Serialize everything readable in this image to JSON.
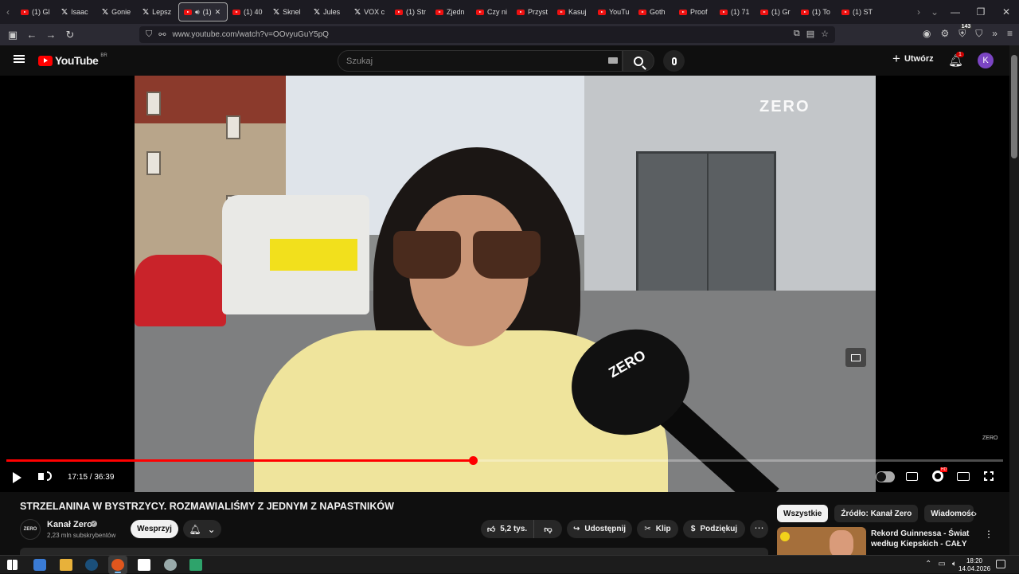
{
  "browser": {
    "tabs": [
      {
        "label": "(1) Gl",
        "icon": "youtube-icon"
      },
      {
        "label": "Isaac",
        "icon": "x-icon"
      },
      {
        "label": "Gonie",
        "icon": "x-icon"
      },
      {
        "label": "Lepsz",
        "icon": "x-icon"
      },
      {
        "label": "(1)",
        "icon": "youtube-icon",
        "active": true
      },
      {
        "label": "(1) 40",
        "icon": "youtube-icon"
      },
      {
        "label": "Sknel",
        "icon": "x-icon"
      },
      {
        "label": "Jules",
        "icon": "x-icon"
      },
      {
        "label": "VOX c",
        "icon": "x-icon"
      },
      {
        "label": "(1) Str",
        "icon": "youtube-icon"
      },
      {
        "label": "Zjedn",
        "icon": "youtube-icon"
      },
      {
        "label": "Czy ni",
        "icon": "youtube-icon"
      },
      {
        "label": "Przyst",
        "icon": "youtube-icon"
      },
      {
        "label": "Kasuj",
        "icon": "youtube-icon"
      },
      {
        "label": "YouTu",
        "icon": "youtube-icon"
      },
      {
        "label": "Goth",
        "icon": "youtube-icon"
      },
      {
        "label": "Proof",
        "icon": "youtube-icon"
      },
      {
        "label": "(1) 71",
        "icon": "youtube-icon"
      },
      {
        "label": "(1) Gr",
        "icon": "youtube-icon"
      },
      {
        "label": "(1) To",
        "icon": "youtube-icon"
      },
      {
        "label": "(1) ST",
        "icon": "youtube-icon"
      }
    ],
    "url": "www.youtube.com/watch?v=OOvyuGuY5pQ",
    "extension_badge": "143"
  },
  "youtube": {
    "logo_text": "YouTube",
    "logo_region": "BR",
    "search_placeholder": "Szukaj",
    "create_label": "Utwórz",
    "notification_count": "1",
    "avatar_letter": "K",
    "avatar_color": "#7b45c3"
  },
  "player": {
    "overlay_brand": "ZERO",
    "mic_brand": "ZERO",
    "watermark": "ZERO",
    "current_time": "17:15",
    "duration": "36:39",
    "time_display": "17:15 / 36:39",
    "progress_fraction": 0.4681,
    "settings_badge": "HD"
  },
  "video": {
    "title": "STRZELANINA W BYSTRZYCY. ROZMAWIALIŚMY Z JEDNYM Z NAPASTNIKÓW",
    "channel_name": "Kanał Zero",
    "channel_logo_text": "ZERO",
    "subscribers": "2,23 mln subskrybentów",
    "support_label": "Wesprzyj",
    "likes": "5,2 tys.",
    "share_label": "Udostępnij",
    "clip_label": "Klip",
    "thanks_label": "Podziękuj"
  },
  "sidebar": {
    "chips": [
      "Wszystkie",
      "Źródło: Kanał Zero",
      "Wiadomości z"
    ],
    "recommended": [
      {
        "title": "Rekord Guinnessa - Świat według Kiepskich - CAŁY ..."
      }
    ]
  },
  "taskbar": {
    "time": "18:20",
    "date": "14.04.2026"
  }
}
